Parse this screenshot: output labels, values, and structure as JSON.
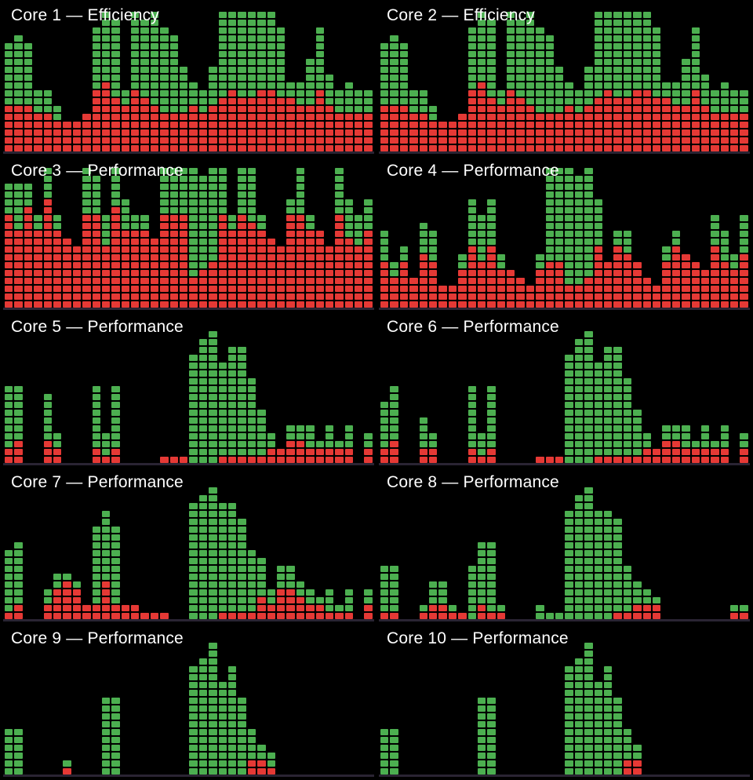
{
  "cells_per_column": 18,
  "columns_per_panel": 38,
  "colors": {
    "system": "#e53935",
    "user": "#4caf50",
    "divider": "#2a2433",
    "bg": "#000000",
    "text": "#ffffff"
  },
  "chart_data": [
    {
      "id": "core1",
      "label": "Core 1 — Efficiency",
      "type": "bar",
      "ylim": [
        0,
        18
      ],
      "series": [
        {
          "name": "system",
          "values": [
            6,
            6,
            6,
            5,
            5,
            4,
            4,
            4,
            5,
            8,
            9,
            7,
            6,
            8,
            7,
            6,
            5,
            5,
            5,
            6,
            5,
            6,
            7,
            8,
            7,
            7,
            8,
            8,
            7,
            7,
            6,
            6,
            8,
            6,
            5,
            5,
            5,
            5
          ]
        },
        {
          "name": "user",
          "values": [
            8,
            9,
            8,
            3,
            3,
            2,
            0,
            0,
            0,
            8,
            9,
            10,
            2,
            10,
            10,
            12,
            11,
            10,
            6,
            3,
            3,
            5,
            11,
            10,
            11,
            11,
            10,
            10,
            9,
            2,
            3,
            6,
            8,
            4,
            3,
            4,
            3,
            3
          ]
        }
      ]
    },
    {
      "id": "core2",
      "label": "Core 2 — Efficiency",
      "type": "bar",
      "ylim": [
        0,
        18
      ],
      "series": [
        {
          "name": "system",
          "values": [
            6,
            6,
            6,
            5,
            5,
            4,
            4,
            4,
            5,
            8,
            9,
            7,
            6,
            8,
            7,
            6,
            5,
            5,
            5,
            6,
            5,
            6,
            7,
            8,
            7,
            7,
            8,
            8,
            7,
            7,
            6,
            6,
            8,
            6,
            5,
            5,
            5,
            5
          ]
        },
        {
          "name": "user",
          "values": [
            8,
            9,
            8,
            3,
            3,
            2,
            0,
            0,
            0,
            8,
            9,
            10,
            2,
            10,
            10,
            12,
            11,
            10,
            6,
            3,
            3,
            5,
            11,
            10,
            11,
            11,
            10,
            10,
            9,
            2,
            3,
            6,
            8,
            4,
            3,
            4,
            3,
            3
          ]
        }
      ]
    },
    {
      "id": "core3",
      "label": "Core 3 — Performance",
      "type": "bar",
      "ylim": [
        0,
        18
      ],
      "series": [
        {
          "name": "system",
          "values": [
            12,
            10,
            13,
            10,
            14,
            10,
            9,
            8,
            12,
            12,
            8,
            13,
            10,
            10,
            10,
            9,
            12,
            12,
            12,
            4,
            5,
            6,
            12,
            10,
            12,
            11,
            10,
            9,
            8,
            12,
            12,
            10,
            10,
            8,
            12,
            9,
            8,
            10
          ]
        },
        {
          "name": "user",
          "values": [
            4,
            6,
            3,
            2,
            4,
            2,
            0,
            0,
            6,
            5,
            4,
            5,
            4,
            2,
            2,
            0,
            6,
            6,
            6,
            14,
            12,
            12,
            6,
            2,
            6,
            7,
            2,
            0,
            0,
            2,
            6,
            2,
            0,
            0,
            6,
            5,
            4,
            4
          ]
        }
      ]
    },
    {
      "id": "core4",
      "label": "Core 4 — Performance",
      "type": "bar",
      "ylim": [
        0,
        18
      ],
      "series": [
        {
          "name": "system",
          "values": [
            6,
            4,
            6,
            4,
            7,
            6,
            3,
            3,
            5,
            8,
            6,
            8,
            5,
            5,
            4,
            3,
            5,
            6,
            6,
            3,
            3,
            4,
            8,
            6,
            8,
            7,
            6,
            4,
            3,
            6,
            8,
            7,
            6,
            5,
            8,
            6,
            5,
            7
          ]
        },
        {
          "name": "user",
          "values": [
            4,
            2,
            2,
            0,
            4,
            4,
            0,
            0,
            2,
            6,
            6,
            6,
            2,
            0,
            0,
            0,
            2,
            12,
            12,
            15,
            14,
            14,
            6,
            0,
            2,
            3,
            0,
            0,
            0,
            2,
            2,
            0,
            0,
            0,
            4,
            4,
            2,
            5
          ]
        }
      ]
    },
    {
      "id": "core5",
      "label": "Core 5 — Performance",
      "type": "bar",
      "ylim": [
        0,
        18
      ],
      "series": [
        {
          "name": "system",
          "values": [
            2,
            3,
            0,
            0,
            3,
            2,
            0,
            0,
            0,
            2,
            1,
            2,
            0,
            0,
            0,
            0,
            1,
            1,
            1,
            0,
            0,
            0,
            1,
            1,
            1,
            1,
            1,
            2,
            2,
            3,
            3,
            2,
            2,
            2,
            2,
            2,
            0,
            2
          ]
        },
        {
          "name": "user",
          "values": [
            8,
            7,
            0,
            0,
            6,
            2,
            0,
            0,
            0,
            8,
            3,
            8,
            0,
            0,
            0,
            0,
            0,
            0,
            0,
            14,
            16,
            17,
            12,
            14,
            14,
            10,
            6,
            2,
            0,
            2,
            2,
            3,
            1,
            3,
            1,
            3,
            0,
            2
          ]
        }
      ]
    },
    {
      "id": "core6",
      "label": "Core 6 — Performance",
      "type": "bar",
      "ylim": [
        0,
        18
      ],
      "series": [
        {
          "name": "system",
          "values": [
            2,
            3,
            0,
            0,
            2,
            2,
            0,
            0,
            0,
            2,
            1,
            2,
            0,
            0,
            0,
            0,
            1,
            1,
            1,
            0,
            0,
            0,
            1,
            1,
            1,
            1,
            1,
            2,
            2,
            3,
            3,
            2,
            2,
            2,
            2,
            2,
            0,
            2
          ]
        },
        {
          "name": "user",
          "values": [
            6,
            7,
            0,
            0,
            4,
            2,
            0,
            0,
            0,
            8,
            3,
            8,
            0,
            0,
            0,
            0,
            0,
            0,
            0,
            14,
            16,
            17,
            12,
            14,
            14,
            10,
            6,
            2,
            0,
            2,
            2,
            3,
            1,
            3,
            1,
            3,
            0,
            2
          ]
        }
      ]
    },
    {
      "id": "core7",
      "label": "Core 7 — Performance",
      "type": "bar",
      "ylim": [
        0,
        18
      ],
      "series": [
        {
          "name": "system",
          "values": [
            1,
            2,
            0,
            0,
            2,
            4,
            5,
            4,
            2,
            2,
            5,
            2,
            2,
            2,
            1,
            1,
            1,
            0,
            0,
            0,
            0,
            0,
            1,
            1,
            1,
            1,
            3,
            2,
            4,
            4,
            3,
            2,
            2,
            1,
            1,
            1,
            0,
            2
          ]
        },
        {
          "name": "user",
          "values": [
            8,
            8,
            0,
            0,
            2,
            2,
            1,
            1,
            0,
            10,
            9,
            10,
            0,
            0,
            0,
            0,
            0,
            0,
            0,
            15,
            16,
            17,
            14,
            14,
            12,
            8,
            5,
            2,
            3,
            3,
            2,
            2,
            1,
            3,
            1,
            3,
            0,
            2
          ]
        }
      ]
    },
    {
      "id": "core8",
      "label": "Core 8 — Performance",
      "type": "bar",
      "ylim": [
        0,
        18
      ],
      "series": [
        {
          "name": "system",
          "values": [
            1,
            1,
            0,
            0,
            1,
            2,
            2,
            1,
            1,
            0,
            2,
            1,
            1,
            0,
            0,
            0,
            0,
            0,
            0,
            0,
            0,
            0,
            0,
            0,
            1,
            1,
            2,
            2,
            2,
            0,
            0,
            0,
            0,
            0,
            0,
            0,
            1,
            1
          ]
        },
        {
          "name": "user",
          "values": [
            6,
            6,
            0,
            0,
            1,
            3,
            3,
            1,
            0,
            7,
            8,
            9,
            1,
            0,
            0,
            0,
            2,
            1,
            1,
            14,
            16,
            17,
            14,
            14,
            12,
            6,
            3,
            2,
            1,
            0,
            0,
            0,
            0,
            0,
            0,
            0,
            1,
            1
          ]
        }
      ]
    },
    {
      "id": "core9",
      "label": "Core 9 — Performance",
      "type": "bar",
      "ylim": [
        0,
        18
      ],
      "series": [
        {
          "name": "system",
          "values": [
            0,
            0,
            0,
            0,
            0,
            0,
            1,
            0,
            0,
            0,
            0,
            0,
            0,
            0,
            0,
            0,
            0,
            0,
            0,
            0,
            0,
            0,
            0,
            0,
            0,
            2,
            2,
            1,
            0,
            0,
            0,
            0,
            0,
            0,
            0,
            0,
            0,
            0
          ]
        },
        {
          "name": "user",
          "values": [
            6,
            6,
            0,
            0,
            0,
            0,
            1,
            0,
            0,
            0,
            10,
            10,
            0,
            0,
            0,
            0,
            0,
            0,
            0,
            14,
            15,
            17,
            12,
            14,
            10,
            4,
            2,
            2,
            0,
            0,
            0,
            0,
            0,
            0,
            0,
            0,
            0,
            0
          ]
        }
      ]
    },
    {
      "id": "core10",
      "label": "Core 10 — Performance",
      "type": "bar",
      "ylim": [
        0,
        18
      ],
      "series": [
        {
          "name": "system",
          "values": [
            0,
            0,
            0,
            0,
            0,
            0,
            0,
            0,
            0,
            0,
            0,
            0,
            0,
            0,
            0,
            0,
            0,
            0,
            0,
            0,
            0,
            0,
            0,
            0,
            0,
            2,
            2,
            0,
            0,
            0,
            0,
            0,
            0,
            0,
            0,
            0,
            0,
            0
          ]
        },
        {
          "name": "user",
          "values": [
            6,
            6,
            0,
            0,
            0,
            0,
            0,
            0,
            0,
            0,
            10,
            10,
            0,
            0,
            0,
            0,
            0,
            0,
            0,
            14,
            15,
            17,
            12,
            14,
            10,
            4,
            2,
            0,
            0,
            0,
            0,
            0,
            0,
            0,
            0,
            0,
            0,
            0
          ]
        }
      ]
    }
  ]
}
